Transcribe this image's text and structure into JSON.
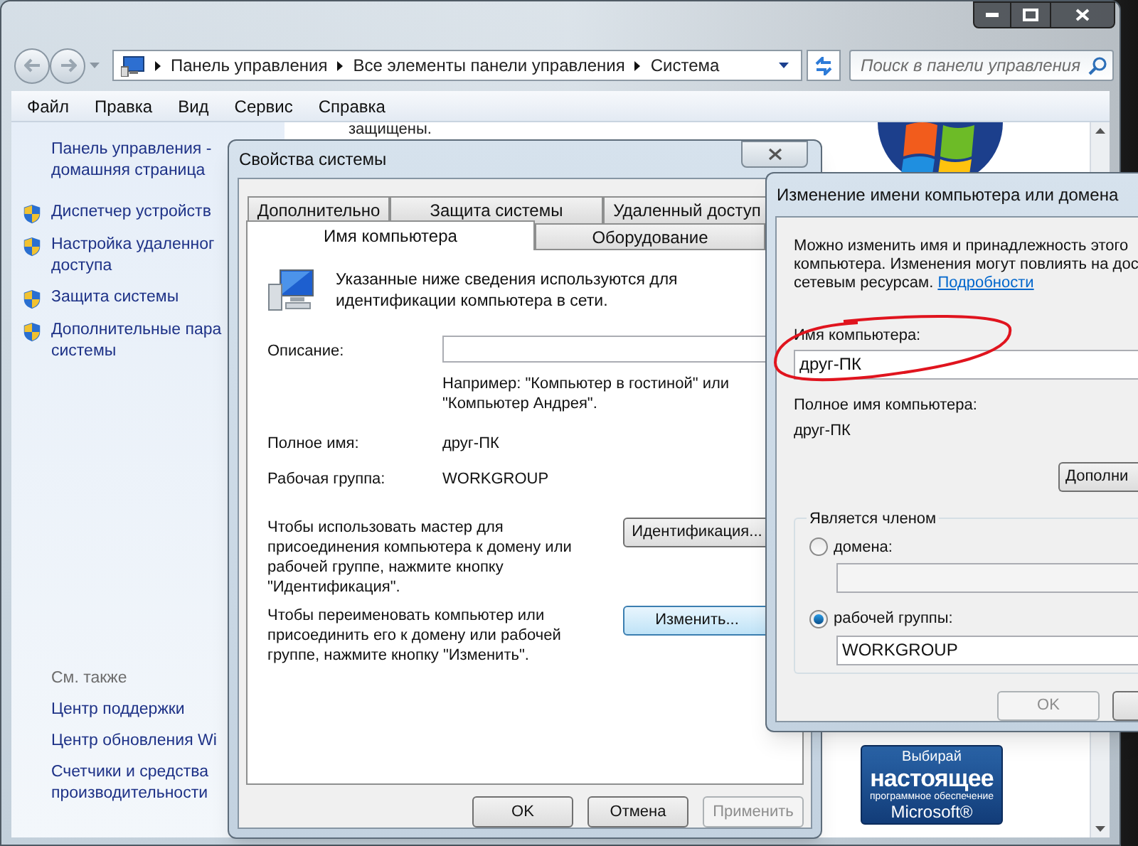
{
  "explorer": {
    "breadcrumbs": [
      "Панель управления",
      "Все элементы панели управления",
      "Система"
    ],
    "search": {
      "placeholder": "Поиск в панели управления"
    },
    "menu": [
      "Файл",
      "Правка",
      "Вид",
      "Сервис",
      "Справка"
    ],
    "sidebar": {
      "items": [
        {
          "kind": "home",
          "lines": [
            "Панель управления -",
            "домашняя страница"
          ]
        },
        {
          "kind": "shield",
          "lines": [
            "Диспетчер устройств"
          ]
        },
        {
          "kind": "shield",
          "lines": [
            "Настройка удаленног",
            "доступа"
          ]
        },
        {
          "kind": "shield",
          "lines": [
            "Защита системы"
          ]
        },
        {
          "kind": "shield",
          "lines": [
            "Дополнительные пара",
            "системы"
          ]
        }
      ],
      "see_also_title": "См. также",
      "see_also": [
        {
          "lines": [
            "Центр поддержки"
          ]
        },
        {
          "lines": [
            "Центр обновления Wi"
          ]
        },
        {
          "lines": [
            "Счетчики и средства",
            "производительности"
          ]
        }
      ]
    },
    "content_fragment": "защищены.",
    "promo_badge": {
      "lines": [
        "Выбирай",
        "настоящее",
        "программное обеспечение",
        "Microsoft®"
      ]
    }
  },
  "system_properties": {
    "title": "Свойства системы",
    "tab_rows": [
      [
        {
          "label": "Дополнительно",
          "selected": false
        },
        {
          "label": "Защита системы",
          "selected": false
        },
        {
          "label": "Удаленный доступ",
          "selected": false
        }
      ],
      [
        {
          "label": "Имя компьютера",
          "selected": true
        },
        {
          "label": "Оборудование",
          "selected": false
        }
      ]
    ],
    "intro": "Указанные ниже сведения используются для идентификации компьютера в сети.",
    "description": {
      "label": "Описание:",
      "hint": "Например: \"Компьютер в гостиной\" или \"Компьютер Андрея\"."
    },
    "full_name": {
      "label": "Полное имя:",
      "value": "друг-ПК"
    },
    "workgroup": {
      "label": "Рабочая группа:",
      "value": "WORKGROUP"
    },
    "actions": [
      {
        "text": "Чтобы использовать мастер для присоединения компьютера к домену или рабочей группе, нажмите кнопку \"Идентификация\".",
        "button": "Идентификация...",
        "highlighted": false
      },
      {
        "text": "Чтобы переименовать компьютер или присоединить его к домену или рабочей группе, нажмите кнопку \"Изменить\".",
        "button": "Изменить...",
        "highlighted": true
      }
    ],
    "buttons": [
      {
        "label": "OK",
        "disabled": false
      },
      {
        "label": "Отмена",
        "disabled": false
      },
      {
        "label": "Применить",
        "disabled": true
      }
    ]
  },
  "rename_dialog": {
    "title": "Изменение имени компьютера или домена",
    "intro_lines": [
      "Можно изменить имя и принадлежность этого",
      "компьютера. Изменения могут повлиять на дос",
      "сетевым ресурсам."
    ],
    "details_link": "Подробности",
    "computer_name": {
      "label": "Имя компьютера:",
      "value": "друг-ПК"
    },
    "full_name": {
      "label": "Полное имя компьютера:",
      "value": "друг-ПК"
    },
    "more_button": "Дополни",
    "member_of": {
      "title": "Является членом",
      "options": [
        {
          "label": "домена:",
          "selected": false
        },
        {
          "label": "рабочей группы:",
          "selected": true,
          "value": "WORKGROUP"
        }
      ]
    },
    "buttons": [
      {
        "label": "OK",
        "disabled": true
      }
    ]
  }
}
